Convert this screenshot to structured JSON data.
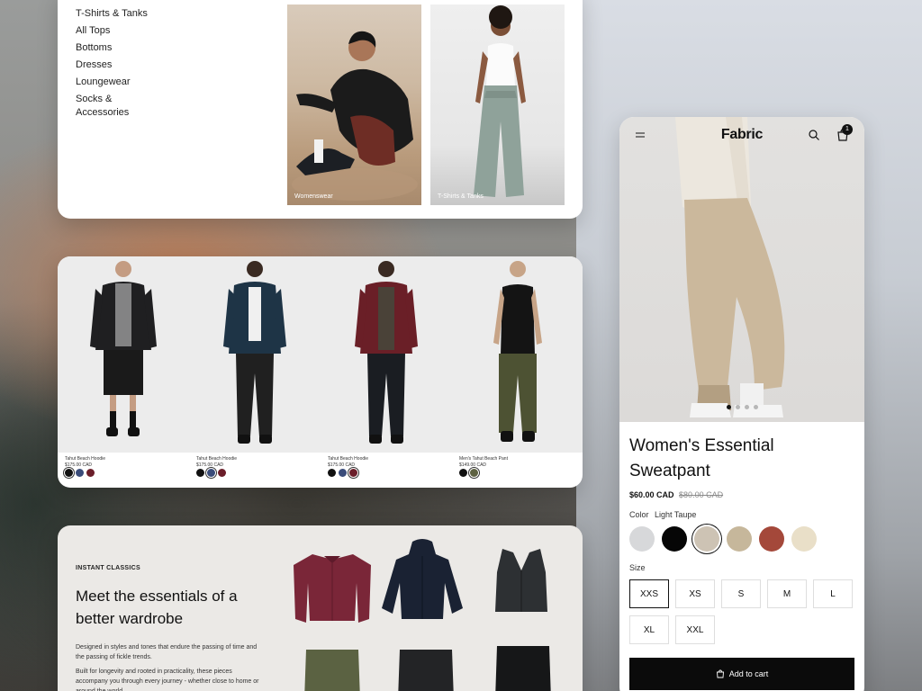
{
  "menu_panel": {
    "categories": [
      "T-Shirts & Tanks",
      "All Tops",
      "Bottoms",
      "Dresses",
      "Loungewear",
      "Socks & Accessories"
    ],
    "promos": [
      {
        "caption": "Womenswear"
      },
      {
        "caption": "T-Shirts & Tanks"
      }
    ]
  },
  "product_grid": {
    "items": [
      {
        "name": "Tahut Beach Hoodie",
        "price": "$175.00 CAD",
        "swatches": [
          "#111111",
          "#3a4c7a",
          "#6b1e2a"
        ],
        "selected": 0
      },
      {
        "name": "Tahut Beach Hoodie",
        "price": "$175.00 CAD",
        "swatches": [
          "#111111",
          "#3a4c7a",
          "#6b1e2a"
        ],
        "selected": 1
      },
      {
        "name": "Tahut Beach Hoodie",
        "price": "$175.00 CAD",
        "swatches": [
          "#111111",
          "#3a4c7a",
          "#6b1e2a"
        ],
        "selected": 2
      },
      {
        "name": "Men's Tahut Beach Pant",
        "price": "$149.00 CAD",
        "swatches": [
          "#111111",
          "#5e6242"
        ],
        "selected": 1
      }
    ]
  },
  "editorial": {
    "eyebrow": "INSTANT CLASSICS",
    "headline": "Meet the essentials of a better wardrobe",
    "body_1": "Designed in styles and tones that endure the passing of time and the passing of fickle trends.",
    "body_2": "Built for longevity and rooted in practicality, these pieces accompany you through every journey - whether close to home or around the world."
  },
  "product_page": {
    "brand": "Fabric",
    "cart_count": "1",
    "gallery_count": 4,
    "gallery_index": 0,
    "title": "Women's Essential Sweatpant",
    "price": "$60.00 CAD",
    "compare_price": "$80.00 CAD",
    "color_label": "Color",
    "selected_color": "Light Taupe",
    "colors": [
      "#d7d8da",
      "#060606",
      "#cdc3b4",
      "#c6b79b",
      "#a4483a",
      "#e9dfc8"
    ],
    "selected_color_index": 2,
    "size_label": "Size",
    "sizes": [
      "XXS",
      "XS",
      "S",
      "M",
      "L",
      "XL",
      "XXL"
    ],
    "selected_size_index": 0,
    "add_to_cart": "Add to cart",
    "icons": [
      "menu-icon",
      "search-icon",
      "cart-icon",
      "bag-icon"
    ]
  }
}
